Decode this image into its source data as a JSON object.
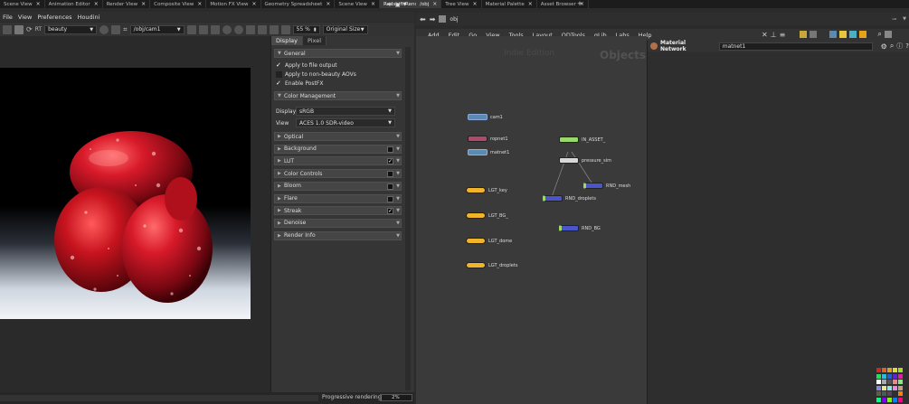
{
  "left_tabs": [
    "Scene View",
    "Animation Editor",
    "Render View",
    "Composite View",
    "Motion FX View",
    "Geometry Spreadsheet",
    "Scene View",
    "Redshift RenderView"
  ],
  "right_tabs": [
    "/obj",
    "Tree View",
    "Material Palette",
    "Asset Browser"
  ],
  "menu": [
    "File",
    "View",
    "Preferences",
    "Houdini"
  ],
  "viewer_toolbar": {
    "rt_label": "RT",
    "aov": "beauty",
    "camera": "/obj/cam1",
    "zoom": "55 %",
    "size_mode": "Original Size"
  },
  "panel_tabs": [
    "Display",
    "Pixel"
  ],
  "panel": {
    "general": "General",
    "apply_file": "Apply to file output",
    "apply_nonbeauty": "Apply to non-beauty AOVs",
    "enable_postfx": "Enable PostFX",
    "color_mgmt": "Color Management",
    "display_label": "Display",
    "display_value": "sRGB",
    "view_label": "View",
    "view_value": "ACES 1.0 SDR-video",
    "sections": [
      "Optical",
      "Background",
      "LUT",
      "Color Controls",
      "Bloom",
      "Flare",
      "Streak",
      "Denoise",
      "Render Info"
    ]
  },
  "status": {
    "label": "Progressive rendering",
    "progress": "2%",
    "progress_value": 0.02
  },
  "network_menu": [
    "Add",
    "Edit",
    "Go",
    "View",
    "Tools",
    "Layout",
    "ODTools",
    "qLib",
    "Labs",
    "Help"
  ],
  "path": "obj",
  "network": {
    "watermark1": "Indie Edition",
    "watermark2": "Objects",
    "nodes": {
      "cam1": "cam1",
      "ropnet1": "ropnet1",
      "matnet1": "matnet1",
      "in_asset": "IN_ASSET_",
      "pressure_sim": "pressure_sim",
      "rnd_mesh": "RND_mesh",
      "rnd_droplets": "RND_droplets",
      "rnd_bg": "RND_BG",
      "lgt_key": "LGT_key",
      "lgt_bg": "LGT_BG_",
      "lgt_dome": "LGT_dome",
      "lgt_droplets": "LGT_droplets"
    }
  },
  "material": {
    "title": "Material Network",
    "name": "matnet1"
  },
  "colors": {
    "accent": "#e8a21a",
    "light": "#f0b42a",
    "rop": "#b04a6a",
    "mat": "#5a8ab0",
    "green": "#9ad86a",
    "blue": "#4a55c8"
  }
}
